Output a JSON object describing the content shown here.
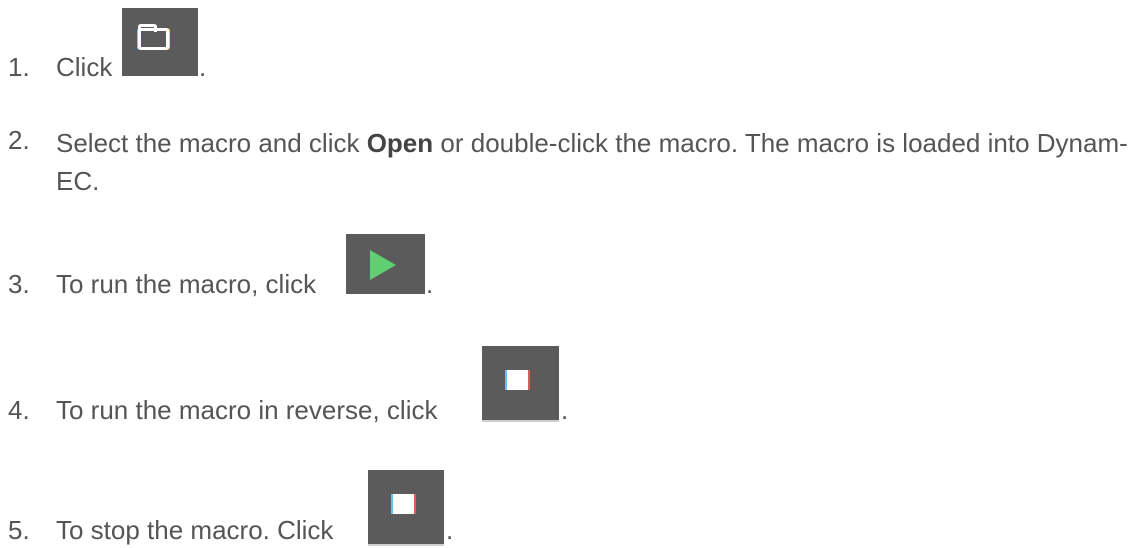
{
  "steps": [
    {
      "number": "1.",
      "text_before": "Click",
      "text_after": "."
    },
    {
      "number": "2.",
      "text_before": "Select the macro and click",
      "bold": "Open",
      "text_after": "or double-click the macro. The macro is loaded into Dynam-EC."
    },
    {
      "number": "3.",
      "text_before": "To run the macro, click",
      "text_after": "."
    },
    {
      "number": "4.",
      "text_before": "To run the macro in reverse, click",
      "text_after": "."
    },
    {
      "number": "5.",
      "text_before": "To stop the macro. Click",
      "text_after": "."
    }
  ],
  "icons": {
    "open": "folder-icon",
    "run": "play-icon",
    "reverse": "stop-icon",
    "stop": "stop-icon"
  },
  "colors": {
    "text": "#555555",
    "button_bg": "#5b5b5b",
    "play": "#5fd072"
  }
}
